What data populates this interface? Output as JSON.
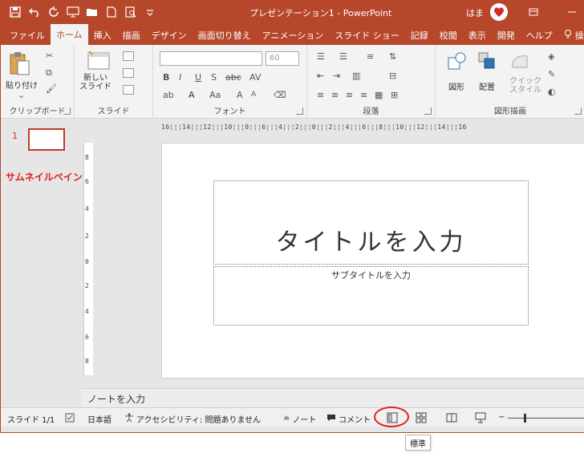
{
  "titlebar": {
    "doc_title": "プレゼンテーション1 - PowerPoint",
    "user_name": "はま",
    "icons": [
      "save-icon",
      "undo-icon",
      "redo-icon",
      "present-icon",
      "open-icon",
      "new-icon",
      "print-preview-icon",
      "customize-qat-icon"
    ],
    "accent_color": "#b7472a"
  },
  "tabs": [
    "ファイル",
    "ホーム",
    "挿入",
    "描画",
    "デザイン",
    "画面切り替え",
    "アニメーション",
    "スライド ショー",
    "記録",
    "校閲",
    "表示",
    "開発",
    "ヘルプ",
    "操作アシ"
  ],
  "active_tab": "ホーム",
  "ribbon": {
    "clipboard": {
      "label": "クリップボード",
      "paste": "貼り付け"
    },
    "slides": {
      "label": "スライド",
      "new_slide": "新しい\nスライド"
    },
    "font": {
      "label": "フォント",
      "font_size": "60"
    },
    "paragraph": {
      "label": "段落"
    },
    "drawing": {
      "label": "図形描画",
      "shapes": "図形",
      "arrange": "配置",
      "quick_styles": "クイック\nスタイル"
    }
  },
  "ruler": {
    "horizontal": "16¦¦¦14¦¦¦12¦¦¦10¦¦¦8¦¦¦6¦¦¦4¦¦¦2¦¦¦0¦¦¦2¦¦¦4¦¦¦6¦¦¦8¦¦¦10¦¦¦12¦¦¦14¦¦¦16",
    "vertical": [
      "8",
      "6",
      "4",
      "2",
      "0",
      "2",
      "4",
      "6",
      "8"
    ]
  },
  "thumbnail_pane": {
    "slide_number": "1",
    "annotation": "サムネイルペイン"
  },
  "slide": {
    "title_placeholder": "タイトルを入力",
    "subtitle_placeholder": "サブタイトルを入力"
  },
  "notes": {
    "placeholder": "ノートを入力"
  },
  "status": {
    "slide_count": "スライド 1/1",
    "language": "日本語",
    "accessibility": "アクセシビリティ: 問題ありません",
    "notes_button": "ノート",
    "comments_button": "コメント",
    "highlight_color": "#e02020"
  },
  "tooltip": {
    "text": "標準"
  }
}
